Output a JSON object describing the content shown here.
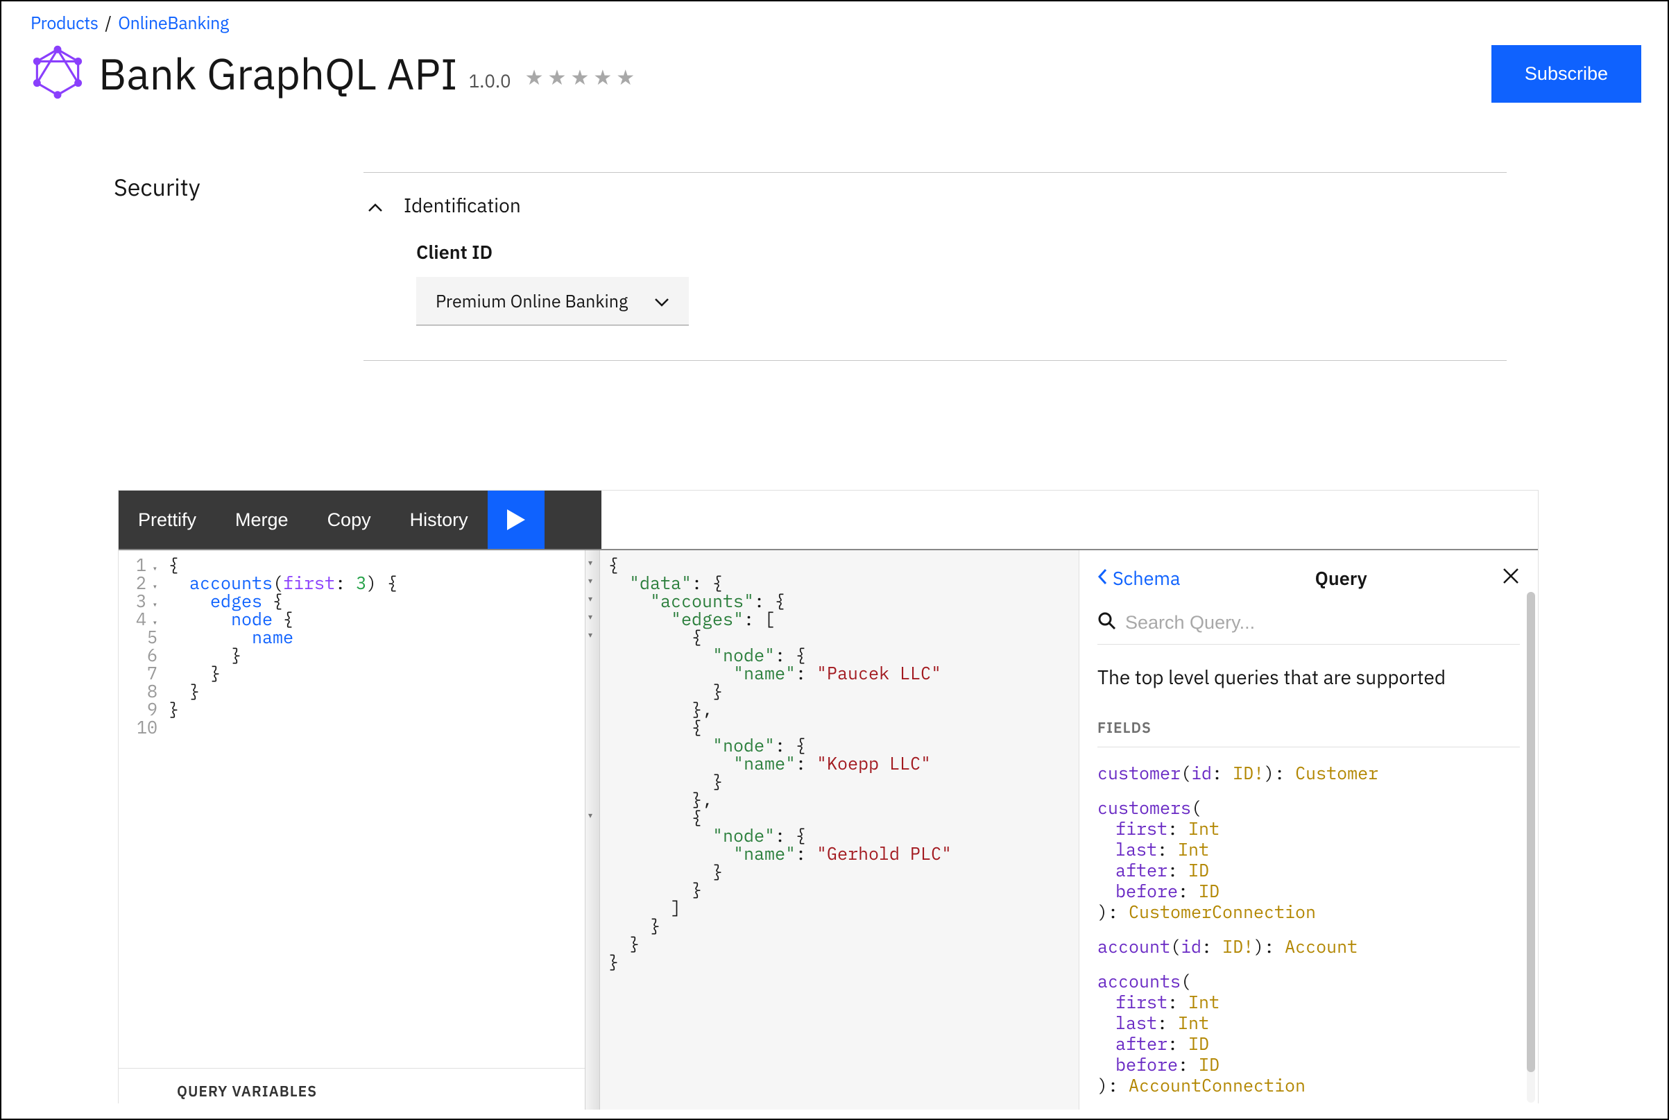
{
  "breadcrumb": {
    "products": "Products",
    "sep": "/",
    "product": "OnlineBanking"
  },
  "header": {
    "title": "Bank GraphQL API",
    "version": "1.0.0",
    "subscribe": "Subscribe"
  },
  "security": {
    "label": "Security",
    "identification": "Identification",
    "client_id_label": "Client ID",
    "client_id_value": "Premium Online Banking"
  },
  "graphiql": {
    "toolbar": {
      "prettify": "Prettify",
      "merge": "Merge",
      "copy": "Copy",
      "history": "History"
    },
    "query_lines": [
      "{",
      "  accounts(first: 3) {",
      "    edges {",
      "      node {",
      "        name",
      "      }",
      "    }",
      "  }",
      "}",
      ""
    ],
    "line_numbers": [
      "1",
      "2",
      "3",
      "4",
      "5",
      "6",
      "7",
      "8",
      "9",
      "10"
    ],
    "result_lines": [
      "{",
      "  \"data\": {",
      "    \"accounts\": {",
      "      \"edges\": [",
      "        {",
      "          \"node\": {",
      "            \"name\": \"Paucek LLC\"",
      "          }",
      "        },",
      "        {",
      "          \"node\": {",
      "            \"name\": \"Koepp LLC\"",
      "          }",
      "        },",
      "        {",
      "          \"node\": {",
      "            \"name\": \"Gerhold PLC\"",
      "          }",
      "        }",
      "      ]",
      "    }",
      "  }",
      "}"
    ],
    "query_variables_label": "QUERY VARIABLES",
    "docs": {
      "back": "Schema",
      "title": "Query",
      "search_placeholder": "Search Query...",
      "description": "The top level queries that are supported",
      "fields_label": "FIELDS",
      "fields": {
        "customer": {
          "name": "customer",
          "arg": "id",
          "argtype": "ID!",
          "ret": "Customer"
        },
        "customers": {
          "name": "customers",
          "args": [
            [
              "first",
              "Int"
            ],
            [
              "last",
              "Int"
            ],
            [
              "after",
              "ID"
            ],
            [
              "before",
              "ID"
            ]
          ],
          "ret": "CustomerConnection"
        },
        "account": {
          "name": "account",
          "arg": "id",
          "argtype": "ID!",
          "ret": "Account"
        },
        "accounts": {
          "name": "accounts",
          "args": [
            [
              "first",
              "Int"
            ],
            [
              "last",
              "Int"
            ],
            [
              "after",
              "ID"
            ],
            [
              "before",
              "ID"
            ]
          ],
          "ret": "AccountConnection"
        }
      }
    }
  }
}
